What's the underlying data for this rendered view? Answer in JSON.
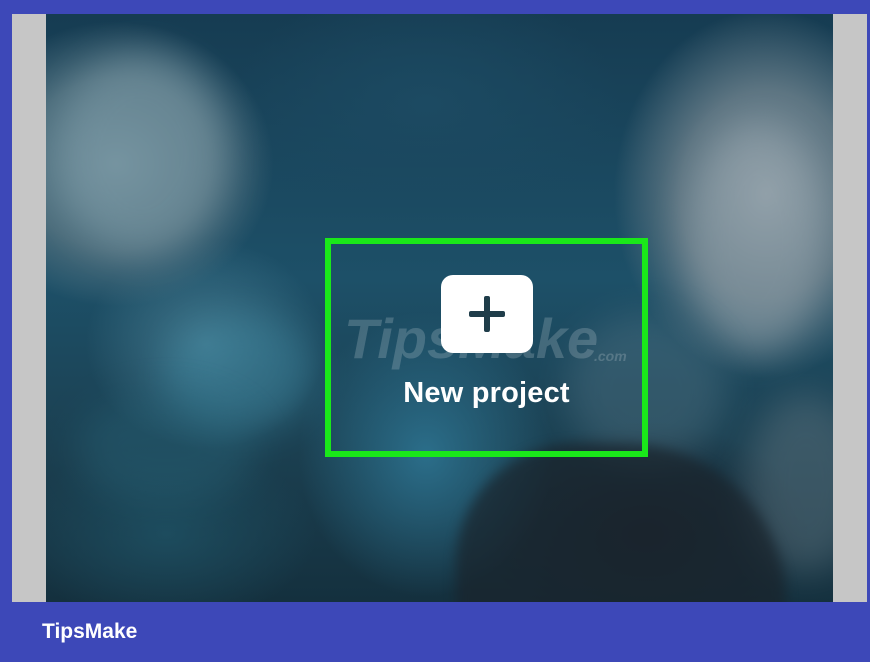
{
  "new_project": {
    "label": "New project",
    "icon": "plus-icon"
  },
  "watermark": {
    "text": "TipsMake",
    "suffix": ".com"
  },
  "footer": {
    "brand": "TipsMake"
  },
  "colors": {
    "frame_border": "#3d48b8",
    "highlight": "#1ae81a",
    "tile": "#ffffff",
    "plus": "#1f3d4a"
  }
}
